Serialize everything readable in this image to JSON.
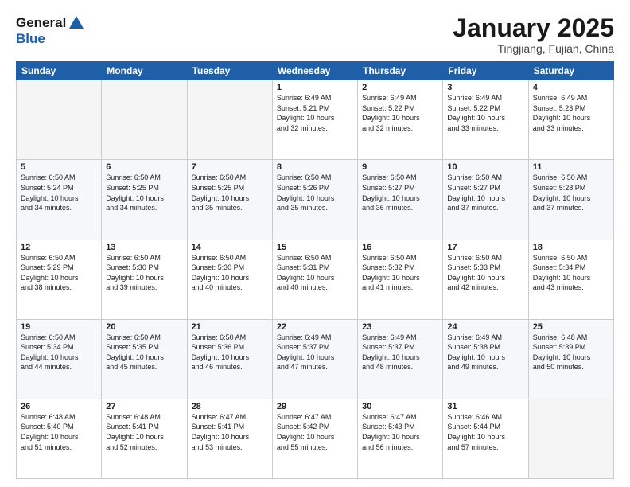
{
  "logo": {
    "general": "General",
    "blue": "Blue"
  },
  "title": "January 2025",
  "subtitle": "Tingjiang, Fujian, China",
  "days_of_week": [
    "Sunday",
    "Monday",
    "Tuesday",
    "Wednesday",
    "Thursday",
    "Friday",
    "Saturday"
  ],
  "weeks": [
    [
      {
        "day": "",
        "info": ""
      },
      {
        "day": "",
        "info": ""
      },
      {
        "day": "",
        "info": ""
      },
      {
        "day": "1",
        "info": "Sunrise: 6:49 AM\nSunset: 5:21 PM\nDaylight: 10 hours\nand 32 minutes."
      },
      {
        "day": "2",
        "info": "Sunrise: 6:49 AM\nSunset: 5:22 PM\nDaylight: 10 hours\nand 32 minutes."
      },
      {
        "day": "3",
        "info": "Sunrise: 6:49 AM\nSunset: 5:22 PM\nDaylight: 10 hours\nand 33 minutes."
      },
      {
        "day": "4",
        "info": "Sunrise: 6:49 AM\nSunset: 5:23 PM\nDaylight: 10 hours\nand 33 minutes."
      }
    ],
    [
      {
        "day": "5",
        "info": "Sunrise: 6:50 AM\nSunset: 5:24 PM\nDaylight: 10 hours\nand 34 minutes."
      },
      {
        "day": "6",
        "info": "Sunrise: 6:50 AM\nSunset: 5:25 PM\nDaylight: 10 hours\nand 34 minutes."
      },
      {
        "day": "7",
        "info": "Sunrise: 6:50 AM\nSunset: 5:25 PM\nDaylight: 10 hours\nand 35 minutes."
      },
      {
        "day": "8",
        "info": "Sunrise: 6:50 AM\nSunset: 5:26 PM\nDaylight: 10 hours\nand 35 minutes."
      },
      {
        "day": "9",
        "info": "Sunrise: 6:50 AM\nSunset: 5:27 PM\nDaylight: 10 hours\nand 36 minutes."
      },
      {
        "day": "10",
        "info": "Sunrise: 6:50 AM\nSunset: 5:27 PM\nDaylight: 10 hours\nand 37 minutes."
      },
      {
        "day": "11",
        "info": "Sunrise: 6:50 AM\nSunset: 5:28 PM\nDaylight: 10 hours\nand 37 minutes."
      }
    ],
    [
      {
        "day": "12",
        "info": "Sunrise: 6:50 AM\nSunset: 5:29 PM\nDaylight: 10 hours\nand 38 minutes."
      },
      {
        "day": "13",
        "info": "Sunrise: 6:50 AM\nSunset: 5:30 PM\nDaylight: 10 hours\nand 39 minutes."
      },
      {
        "day": "14",
        "info": "Sunrise: 6:50 AM\nSunset: 5:30 PM\nDaylight: 10 hours\nand 40 minutes."
      },
      {
        "day": "15",
        "info": "Sunrise: 6:50 AM\nSunset: 5:31 PM\nDaylight: 10 hours\nand 40 minutes."
      },
      {
        "day": "16",
        "info": "Sunrise: 6:50 AM\nSunset: 5:32 PM\nDaylight: 10 hours\nand 41 minutes."
      },
      {
        "day": "17",
        "info": "Sunrise: 6:50 AM\nSunset: 5:33 PM\nDaylight: 10 hours\nand 42 minutes."
      },
      {
        "day": "18",
        "info": "Sunrise: 6:50 AM\nSunset: 5:34 PM\nDaylight: 10 hours\nand 43 minutes."
      }
    ],
    [
      {
        "day": "19",
        "info": "Sunrise: 6:50 AM\nSunset: 5:34 PM\nDaylight: 10 hours\nand 44 minutes."
      },
      {
        "day": "20",
        "info": "Sunrise: 6:50 AM\nSunset: 5:35 PM\nDaylight: 10 hours\nand 45 minutes."
      },
      {
        "day": "21",
        "info": "Sunrise: 6:50 AM\nSunset: 5:36 PM\nDaylight: 10 hours\nand 46 minutes."
      },
      {
        "day": "22",
        "info": "Sunrise: 6:49 AM\nSunset: 5:37 PM\nDaylight: 10 hours\nand 47 minutes."
      },
      {
        "day": "23",
        "info": "Sunrise: 6:49 AM\nSunset: 5:37 PM\nDaylight: 10 hours\nand 48 minutes."
      },
      {
        "day": "24",
        "info": "Sunrise: 6:49 AM\nSunset: 5:38 PM\nDaylight: 10 hours\nand 49 minutes."
      },
      {
        "day": "25",
        "info": "Sunrise: 6:48 AM\nSunset: 5:39 PM\nDaylight: 10 hours\nand 50 minutes."
      }
    ],
    [
      {
        "day": "26",
        "info": "Sunrise: 6:48 AM\nSunset: 5:40 PM\nDaylight: 10 hours\nand 51 minutes."
      },
      {
        "day": "27",
        "info": "Sunrise: 6:48 AM\nSunset: 5:41 PM\nDaylight: 10 hours\nand 52 minutes."
      },
      {
        "day": "28",
        "info": "Sunrise: 6:47 AM\nSunset: 5:41 PM\nDaylight: 10 hours\nand 53 minutes."
      },
      {
        "day": "29",
        "info": "Sunrise: 6:47 AM\nSunset: 5:42 PM\nDaylight: 10 hours\nand 55 minutes."
      },
      {
        "day": "30",
        "info": "Sunrise: 6:47 AM\nSunset: 5:43 PM\nDaylight: 10 hours\nand 56 minutes."
      },
      {
        "day": "31",
        "info": "Sunrise: 6:46 AM\nSunset: 5:44 PM\nDaylight: 10 hours\nand 57 minutes."
      },
      {
        "day": "",
        "info": ""
      }
    ]
  ]
}
